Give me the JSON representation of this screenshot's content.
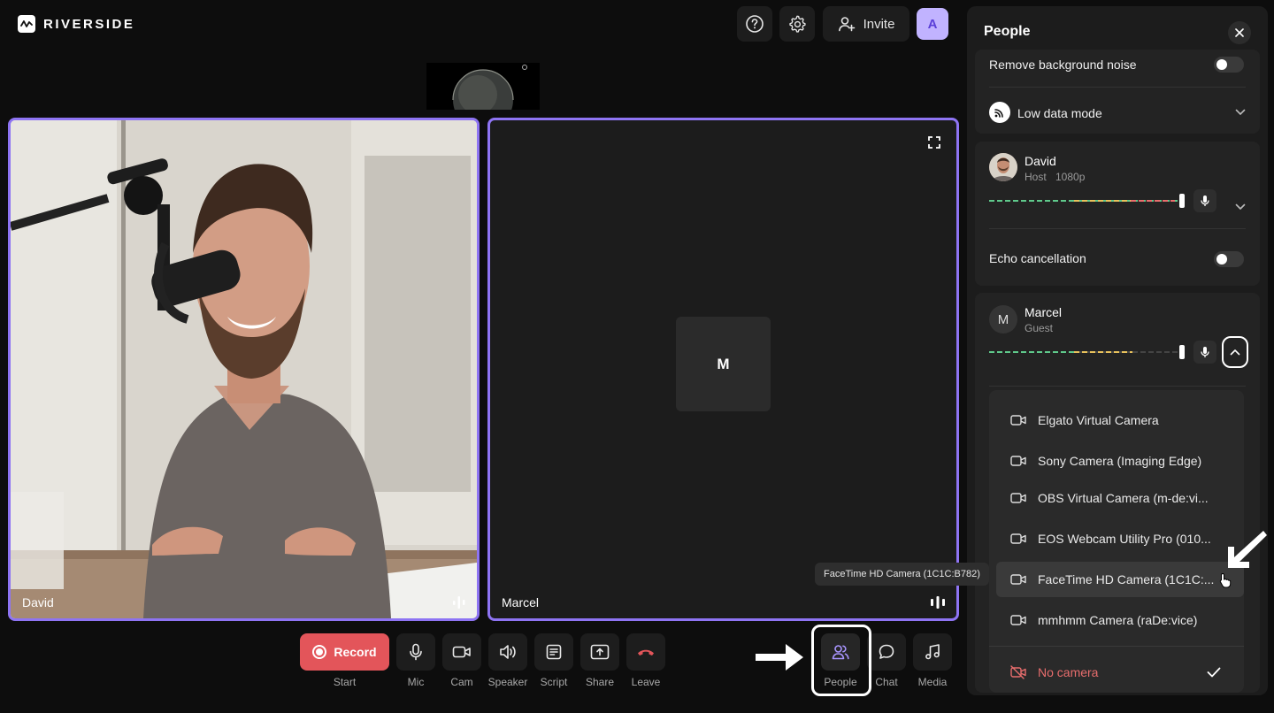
{
  "app": {
    "brand": "RIVERSIDE"
  },
  "header": {
    "invite_label": "Invite",
    "user_initial": "A"
  },
  "tiles": {
    "david": {
      "name": "David"
    },
    "marcel": {
      "name": "Marcel",
      "initial": "M"
    }
  },
  "toolbar": {
    "record_label": "Record",
    "start_label": "Start",
    "mic_label": "Mic",
    "cam_label": "Cam",
    "speaker_label": "Speaker",
    "script_label": "Script",
    "share_label": "Share",
    "leave_label": "Leave",
    "people_label": "People",
    "chat_label": "Chat",
    "media_label": "Media"
  },
  "panel": {
    "title": "People",
    "remove_noise_label": "Remove background noise",
    "remove_noise_on": false,
    "low_data_label": "Low data mode",
    "participants": [
      {
        "name": "David",
        "role": "Host",
        "quality": "1080p",
        "echo_label": "Echo cancellation",
        "echo_on": false
      },
      {
        "name": "Marcel",
        "initial": "M",
        "role": "Guest"
      }
    ],
    "camera_menu": {
      "options": [
        "Elgato Virtual Camera",
        "Sony Camera (Imaging Edge)",
        "OBS Virtual Camera (m-de:vi...",
        "EOS Webcam Utility Pro (010...",
        "FaceTime HD Camera (1C1C:...",
        "mmhmm Camera (raDe:vice)"
      ],
      "hovered_index": 4,
      "no_camera_label": "No camera",
      "selected": "No camera"
    }
  },
  "tooltip": "FaceTime HD Camera (1C1C:B782)",
  "colors": {
    "accent": "#8e74f3",
    "record": "#e3555a",
    "danger": "#e86d6d",
    "avatar_bg": "#c1b3ff"
  }
}
